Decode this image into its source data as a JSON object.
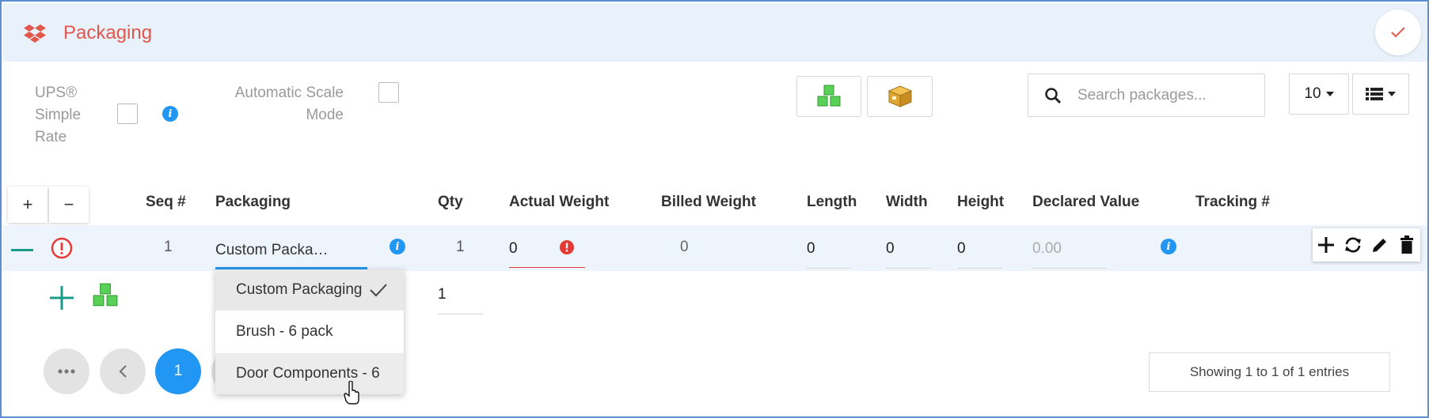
{
  "header": {
    "title": "Packaging",
    "icon": "dropbox-icon",
    "confirm_icon": "check-icon"
  },
  "options": {
    "ups_simple_rate": {
      "line1": "UPS®",
      "line2": "Simple",
      "line3": "Rate",
      "checked": false
    },
    "automatic_scale_mode": {
      "line1": "Automatic Scale",
      "line2": "Mode",
      "checked": false
    }
  },
  "toolbar": {
    "search_placeholder": "Search packages...",
    "page_size": "10",
    "buttons": [
      "green-boxes-icon",
      "box-icon"
    ]
  },
  "table": {
    "add_row_label": "+",
    "remove_row_label": "−",
    "columns": {
      "seq": "Seq #",
      "packaging": "Packaging",
      "qty": "Qty",
      "actual_weight": "Actual Weight",
      "billed_weight": "Billed Weight",
      "length": "Length",
      "width": "Width",
      "height": "Height",
      "declared_value": "Declared Value",
      "tracking": "Tracking #"
    },
    "row": {
      "seq": "1",
      "packaging": "Custom Packa…",
      "qty": "1",
      "actual_weight": "0",
      "billed_weight": "0",
      "length": "0",
      "width": "0",
      "height": "0",
      "declared_value": "0.00",
      "tracking": ""
    },
    "new_row_qty": "1"
  },
  "dropdown": {
    "items": [
      {
        "label": "Custom Packaging",
        "selected": true
      },
      {
        "label": "Brush - 6 pack",
        "selected": false
      },
      {
        "label": "Door Components - 6",
        "selected": false,
        "hovered": true
      }
    ]
  },
  "pagination": {
    "current_page": "1",
    "summary": "Showing 1 to 1 of 1 entries"
  },
  "colors": {
    "accent": "#2196f3",
    "title": "#e2574c",
    "error": "#e53935",
    "teal": "#1a9b8a",
    "header_bg": "#e9f1fb",
    "row_bg": "#eef4fb"
  }
}
